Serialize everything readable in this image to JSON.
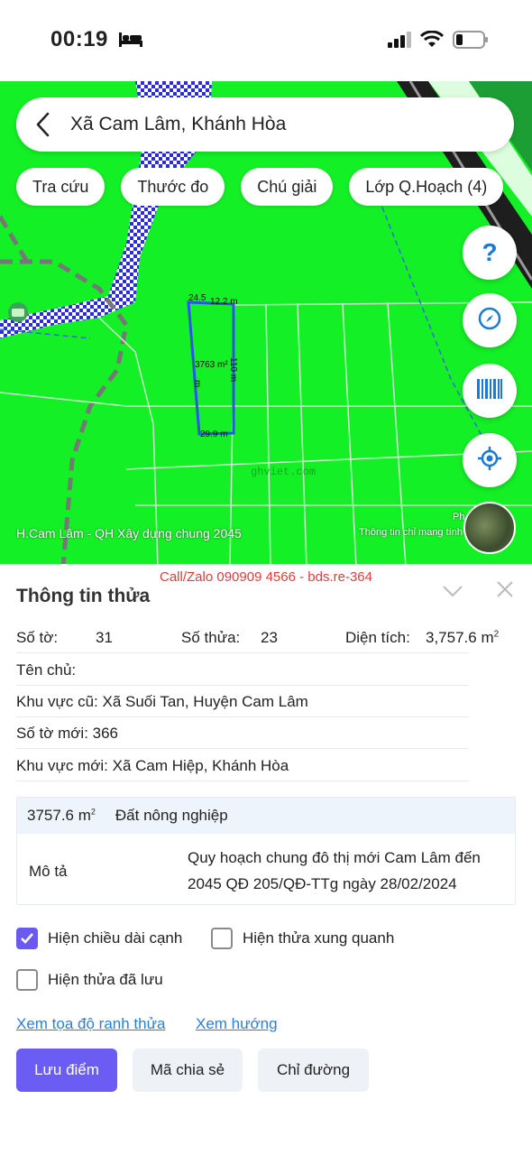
{
  "status": {
    "time": "00:19"
  },
  "search": {
    "text": "Xã Cam Lâm, Khánh Hòa"
  },
  "chips": [
    "Tra cứu",
    "Thước đo",
    "Chú giải",
    "Lớp Q.Hoạch (4)"
  ],
  "map": {
    "labels": {
      "top_left": "24.5",
      "top_right": "12.2 m",
      "area": "3763 m²",
      "left_side": "m",
      "right_side": "110 m",
      "bottom": "29.9 m",
      "watermark": "ghviet.com"
    },
    "caption": "H.Cam Lâm - QH Xây dựng chung 2045",
    "caption_right": "Thông tin chỉ mang tính",
    "caption_right_top": "Ph",
    "colors": {
      "land": "#14f026",
      "residential": "#2d2dd6",
      "road": "#1e1e1e"
    }
  },
  "panel": {
    "watermark": "Call/Zalo 090909 4566 - bds.re-364",
    "title": "Thông tin thửa",
    "so_to_label": "Số tờ:",
    "so_to_value": "31",
    "so_thua_label": "Số thửa:",
    "so_thua_value": "23",
    "dien_tich_label": "Diện tích:",
    "dien_tich_value": "3,757.6 m",
    "dien_tich_sup": "2",
    "ten_chu": "Tên chủ:",
    "khu_vuc_cu": "Khu vực cũ: Xã Suối Tan, Huyện Cam Lâm",
    "so_to_moi": "Số tờ mới: 366",
    "khu_vuc_moi": "Khu vực mới: Xã Cam Hiệp, Khánh Hòa",
    "card": {
      "area": "3757.6 m",
      "area_sup": "2",
      "type": "Đất nông nghiệp",
      "desc_label": "Mô tả",
      "desc": "Quy hoạch chung đô thị mới Cam Lâm đến 2045 QĐ 205/QĐ-TTg ngày 28/02/2024"
    },
    "checkboxes": [
      {
        "label": "Hiện chiều dài cạnh",
        "checked": true
      },
      {
        "label": "Hiện thửa xung quanh",
        "checked": false
      },
      {
        "label": "Hiện thửa đã lưu",
        "checked": false
      }
    ],
    "links": [
      "Xem tọa độ ranh thửa",
      "Xem hướng"
    ],
    "buttons": [
      "Lưu điểm",
      "Mã chia sẻ",
      "Chỉ đường"
    ]
  }
}
